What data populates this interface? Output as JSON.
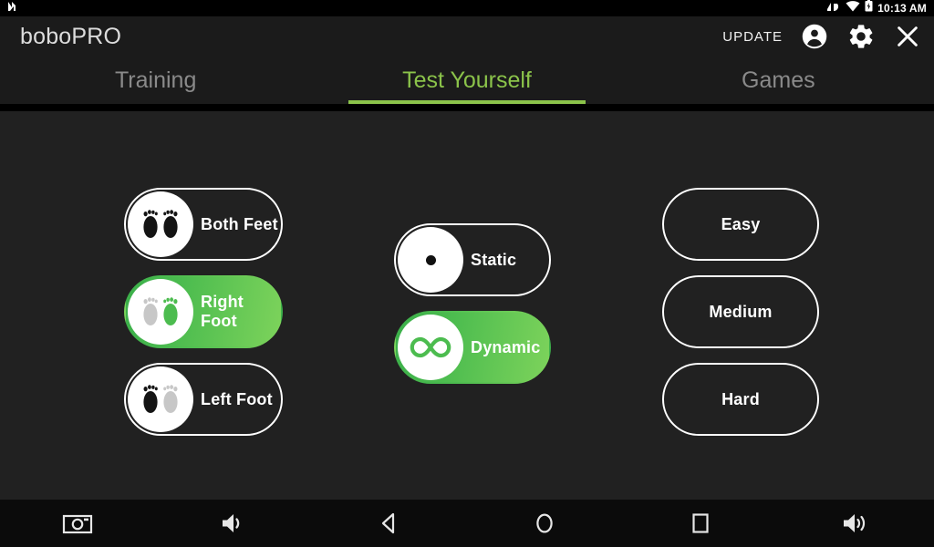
{
  "statusbar": {
    "time": "10:13 AM",
    "icons": [
      "notification-n-icon",
      "signal-icon",
      "wifi-icon",
      "battery-charging-icon"
    ]
  },
  "appbar": {
    "title": "boboPRO",
    "update_label": "UPDATE",
    "icons": [
      "account-icon",
      "gear-icon",
      "close-icon"
    ]
  },
  "tabs": {
    "items": [
      {
        "label": "Training",
        "active": false
      },
      {
        "label": "Test Yourself",
        "active": true
      },
      {
        "label": "Games",
        "active": false
      }
    ],
    "active_color": "#8BC34A",
    "inactive_color": "#8a8a8a"
  },
  "main": {
    "foot_options": [
      {
        "label": "Both Feet",
        "icon": "both-feet-icon",
        "selected": false
      },
      {
        "label": "Right Foot",
        "icon": "right-foot-icon",
        "selected": true
      },
      {
        "label": "Left Foot",
        "icon": "left-foot-icon",
        "selected": false
      }
    ],
    "mode_options": [
      {
        "label": "Static",
        "icon": "dot-icon",
        "selected": false
      },
      {
        "label": "Dynamic",
        "icon": "infinity-icon",
        "selected": true
      }
    ],
    "difficulty_options": [
      {
        "label": "Easy",
        "selected": false
      },
      {
        "label": "Medium",
        "selected": false
      },
      {
        "label": "Hard",
        "selected": false
      }
    ]
  },
  "navbar": {
    "items": [
      {
        "icon": "screenshot-camera-icon"
      },
      {
        "icon": "volume-down-icon"
      },
      {
        "icon": "back-icon"
      },
      {
        "icon": "home-icon"
      },
      {
        "icon": "recents-icon"
      },
      {
        "icon": "volume-up-icon"
      }
    ]
  },
  "colors": {
    "accent_green": "#8BC34A",
    "selected_green_start": "#3BAF4A",
    "selected_green_end": "#7DD35B",
    "background": "#212121",
    "bar_background": "#1b1b1b"
  }
}
